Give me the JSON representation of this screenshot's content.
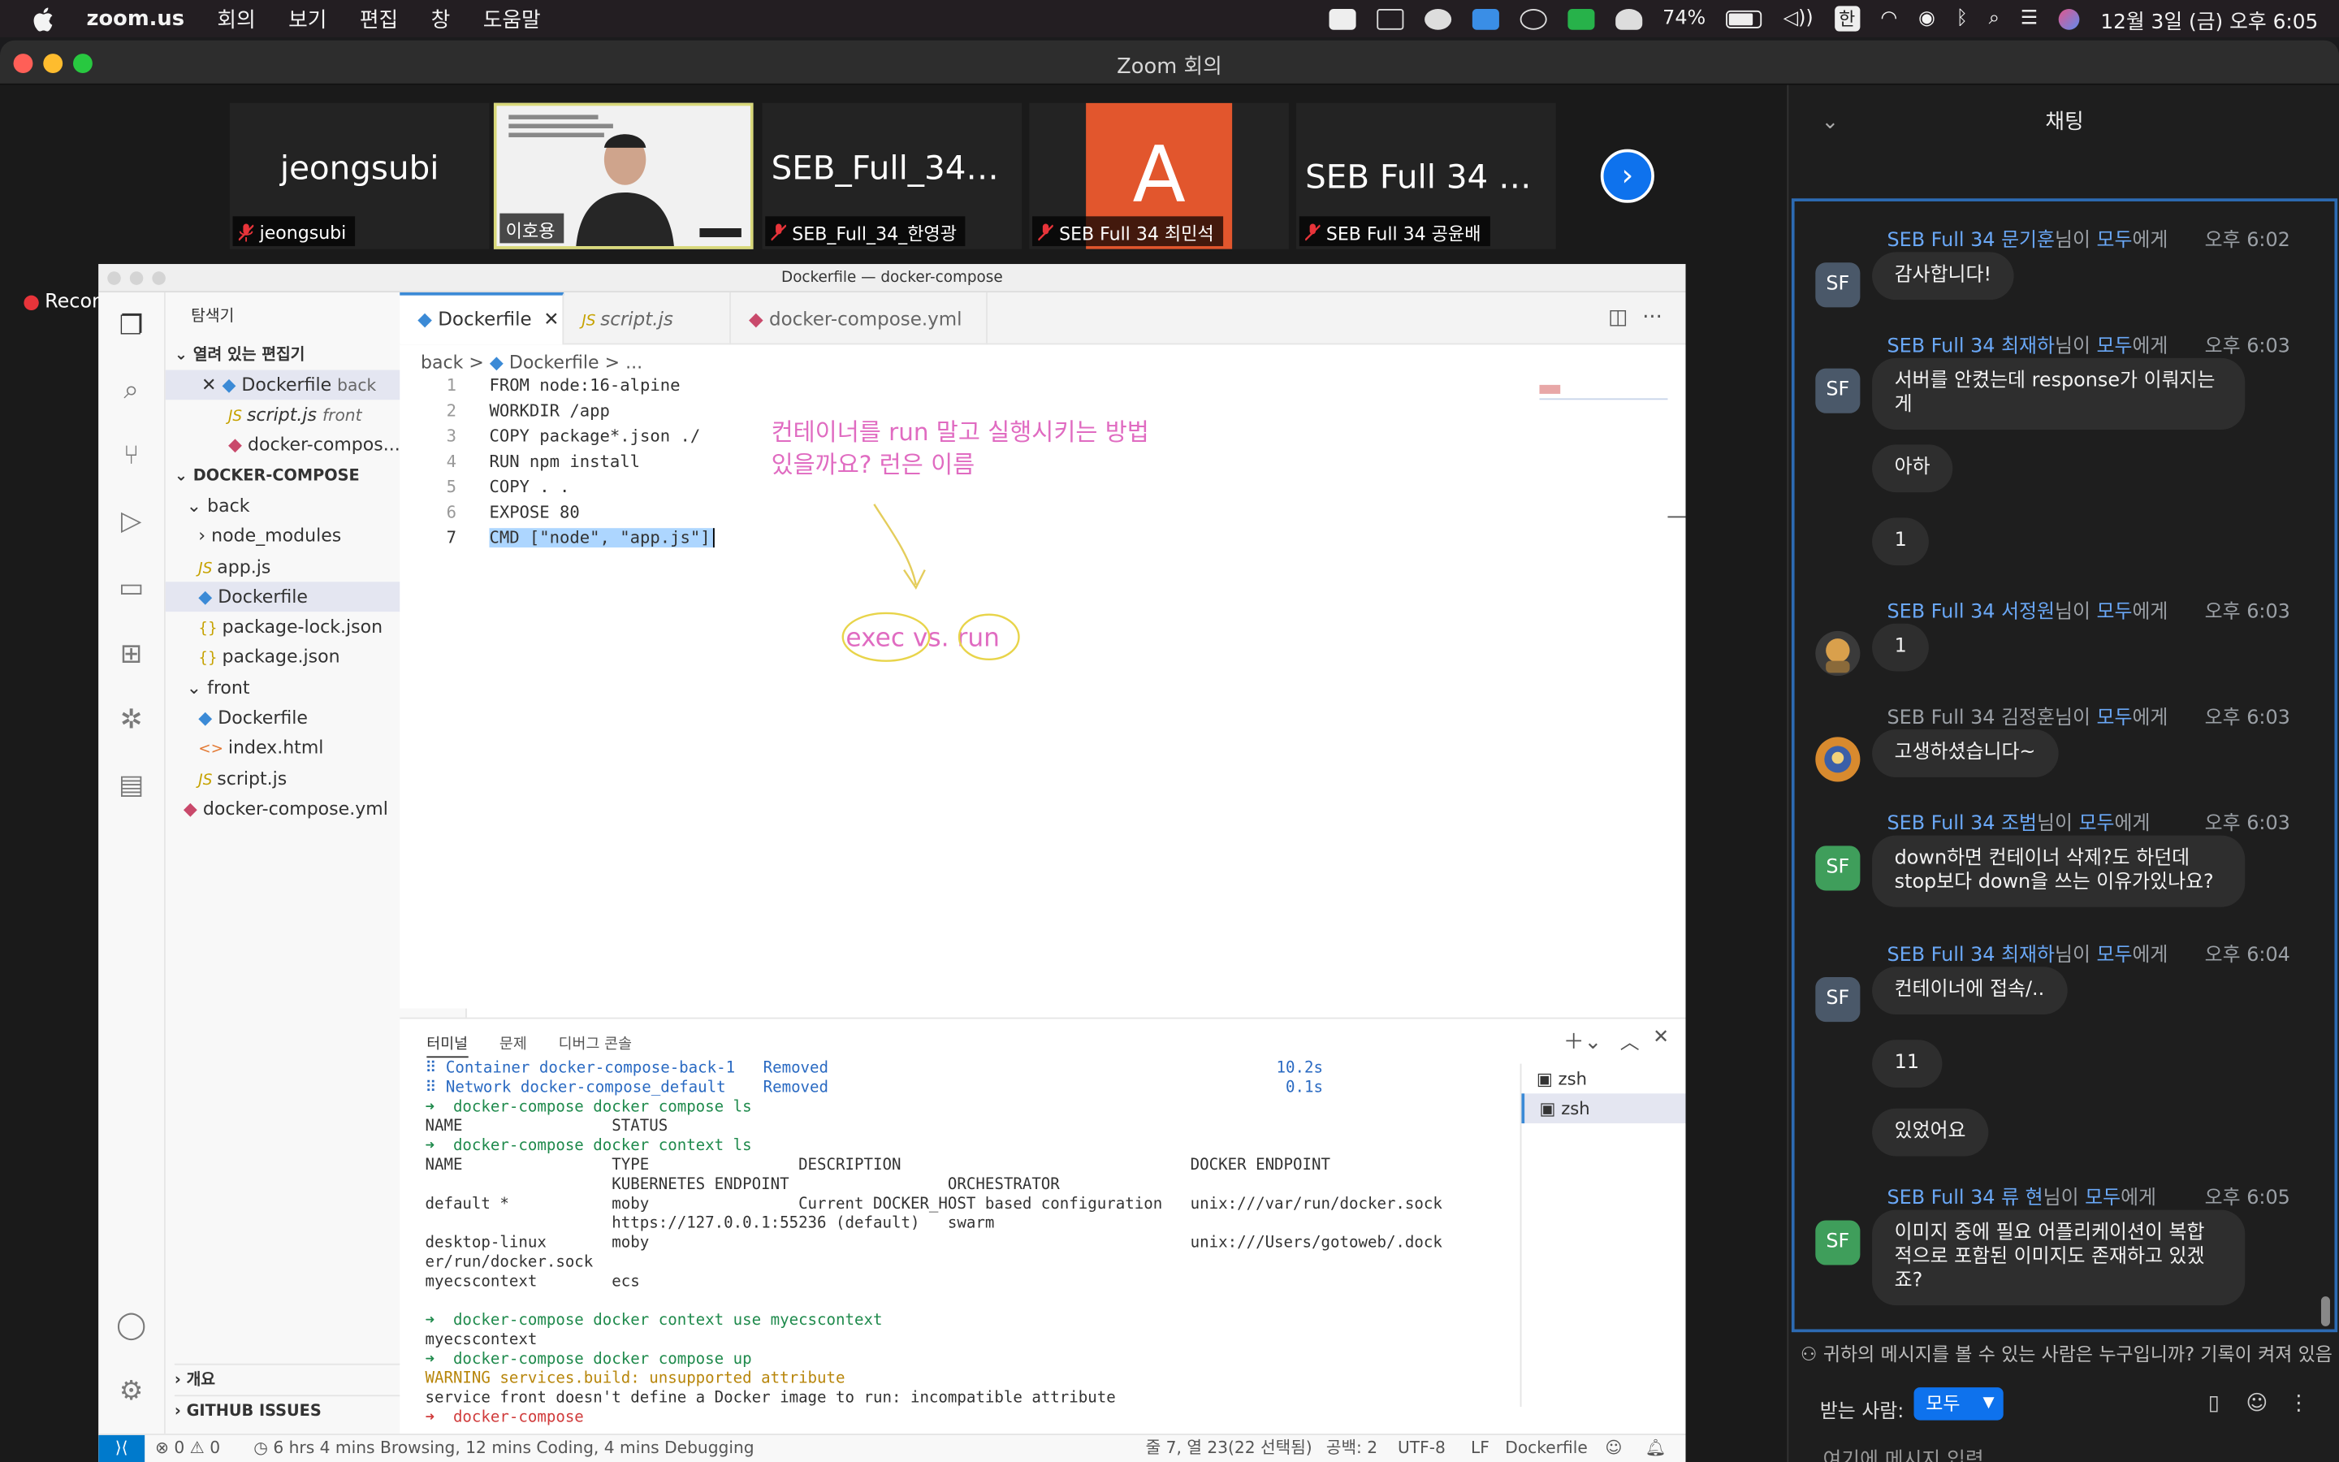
{
  "menubar": {
    "app": "zoom.us",
    "menus": [
      "회의",
      "보기",
      "편집",
      "창",
      "도움말"
    ],
    "battery": "74%",
    "input_method": "한",
    "datetime": "12월 3일 (금) 오후 6:05"
  },
  "window": {
    "title": "Zoom 회의"
  },
  "participants": [
    {
      "name": "jeongsubi",
      "display": "jeongsubi",
      "muted": true
    },
    {
      "name": "이호용",
      "display": "",
      "muted": false
    },
    {
      "name": "SEB_Full_34_한영광",
      "display": "SEB_Full_34_…",
      "muted": true
    },
    {
      "name": "SEB Full 34 최민석",
      "display": "A",
      "muted": true
    },
    {
      "name": "SEB Full 34 공윤배",
      "display": "SEB Full 34 공…",
      "muted": true
    }
  ],
  "recording": "Recording",
  "vscode": {
    "title": "Dockerfile — docker-compose",
    "explorer_label": "탐색기",
    "open_editors_label": "열려 있는 편집기",
    "open_editors": [
      {
        "file": "Dockerfile",
        "hint": "back"
      },
      {
        "file": "script.js",
        "hint": "front"
      },
      {
        "file": "docker-compos...",
        "hint": ""
      }
    ],
    "workspace": "DOCKER-COMPOSE",
    "tree": {
      "back": "back",
      "node_modules": "node_modules",
      "app_js": "app.js",
      "back_dockerfile": "Dockerfile",
      "package_lock": "package-lock.json",
      "package_json": "package.json",
      "front": "front",
      "front_dockerfile": "Dockerfile",
      "index_html": "index.html",
      "script_js": "script.js",
      "compose_yml": "docker-compose.yml"
    },
    "outline": "개요",
    "github": "GITHUB ISSUES",
    "tabs": [
      "Dockerfile",
      "script.js",
      "docker-compose.yml"
    ],
    "breadcrumb": {
      "folder": "back",
      "file": "Dockerfile",
      "more": "..."
    },
    "code": [
      "FROM node:16-alpine",
      "WORKDIR /app",
      "COPY package*.json ./",
      "RUN npm install",
      "COPY . .",
      "EXPOSE 80",
      "CMD [\"node\", \"app.js\"]"
    ],
    "annotation": [
      "컨테이너를 run  말고 실행시키는 방법",
      "있을까요? 런은 이름"
    ],
    "annotation2": "exec vs. run",
    "panel_tabs": [
      "터미널",
      "문제",
      "디버그 콘솔"
    ],
    "terminal_lines": [
      "⠿ Container docker-compose-back-1   Removed                                                10.2s",
      "⠿ Network docker-compose_default    Removed                                                 0.1s",
      "➜  docker-compose docker compose ls",
      "NAME                STATUS",
      "➜  docker-compose docker context ls",
      "NAME                TYPE                DESCRIPTION                               DOCKER ENDPOINT",
      "                    KUBERNETES ENDPOINT                 ORCHESTRATOR",
      "default *           moby                Current DOCKER_HOST based configuration   unix:///var/run/docker.sock",
      "                    https://127.0.0.1:55236 (default)   swarm",
      "desktop-linux       moby                                                          unix:///Users/gotoweb/.dock",
      "er/run/docker.sock",
      "myecscontext        ecs",
      "",
      "➜  docker-compose docker context use myecscontext",
      "myecscontext",
      "➜  docker-compose docker compose up",
      "WARNING services.build: unsupported attribute",
      "service front doesn't define a Docker image to run: incompatible attribute",
      "➜  docker-compose "
    ],
    "terminals": [
      "zsh",
      "zsh"
    ],
    "status": {
      "errors": "0",
      "warnings": "0",
      "wakatime": "6 hrs 4 mins Browsing, 12 mins Coding, 4 mins Debugging",
      "position": "줄 7, 열 23(22 선택됨)",
      "spaces": "공백: 2",
      "encoding": "UTF-8",
      "eol": "LF",
      "language": "Dockerfile"
    }
  },
  "chat": {
    "title": "채팅",
    "messages": [
      {
        "sender": "SEB Full 34 문기훈",
        "suffix": "님이",
        "to": "모두",
        "to_suffix": "에게",
        "time": "오후 6:02",
        "text": "감사합니다!",
        "avatar": "SF"
      },
      {
        "sender": "SEB Full 34 최재하",
        "suffix": "님이",
        "to": "모두",
        "to_suffix": "에게",
        "time": "오후 6:03",
        "text": "서버를 안켰는데 response가 이뤄지는\n게",
        "avatar": "SF"
      },
      {
        "text": "아하"
      },
      {
        "text": "1"
      },
      {
        "sender": "SEB Full 34 서정원",
        "suffix": "님이",
        "to": "모두",
        "to_suffix": "에게",
        "time": "오후 6:03",
        "text": "1",
        "avatar": "img"
      },
      {
        "sender": "SEB Full 34 김정훈",
        "suffix": "님이",
        "to": "모두",
        "to_suffix": "에게",
        "time": "오후 6:03",
        "text": "고생하셨습니다~",
        "avatar": "img"
      },
      {
        "sender": "SEB Full 34 조범",
        "suffix": "님이",
        "to": "모두",
        "to_suffix": "에게",
        "time": "오후 6:03",
        "text": "down하면 컨테이너 삭제?도 하던데\nstop보다 down을 쓰는 이유가있나요?",
        "avatar": "SF"
      },
      {
        "sender": "SEB Full 34 최재하",
        "suffix": "님이",
        "to": "모두",
        "to_suffix": "에게",
        "time": "오후 6:04",
        "text": "컨테이너에 접속/..",
        "avatar": "SF"
      },
      {
        "text": "11"
      },
      {
        "text": "있었어요"
      },
      {
        "sender": "SEB Full 34 류 현",
        "suffix": "님이",
        "to": "모두",
        "to_suffix": "에게",
        "time": "오후 6:05",
        "text": "이미지 중에 필요 어플리케이션이 복합\n적으로 포함된 이미지도 존재하고 있겠\n죠?",
        "avatar": "SF"
      }
    ],
    "notice": "귀하의 메시지를 볼 수 있는 사람은 누구입니까? 기록이 켜져 있음",
    "recipient_label": "받는 사람:",
    "recipient": "모두",
    "input_placeholder": "여기에 메시지 입력..."
  },
  "colors": {
    "zoom_blue": "#0e72ed",
    "chat_border": "#2d6bb3",
    "vscode_blue": "#007acc"
  }
}
